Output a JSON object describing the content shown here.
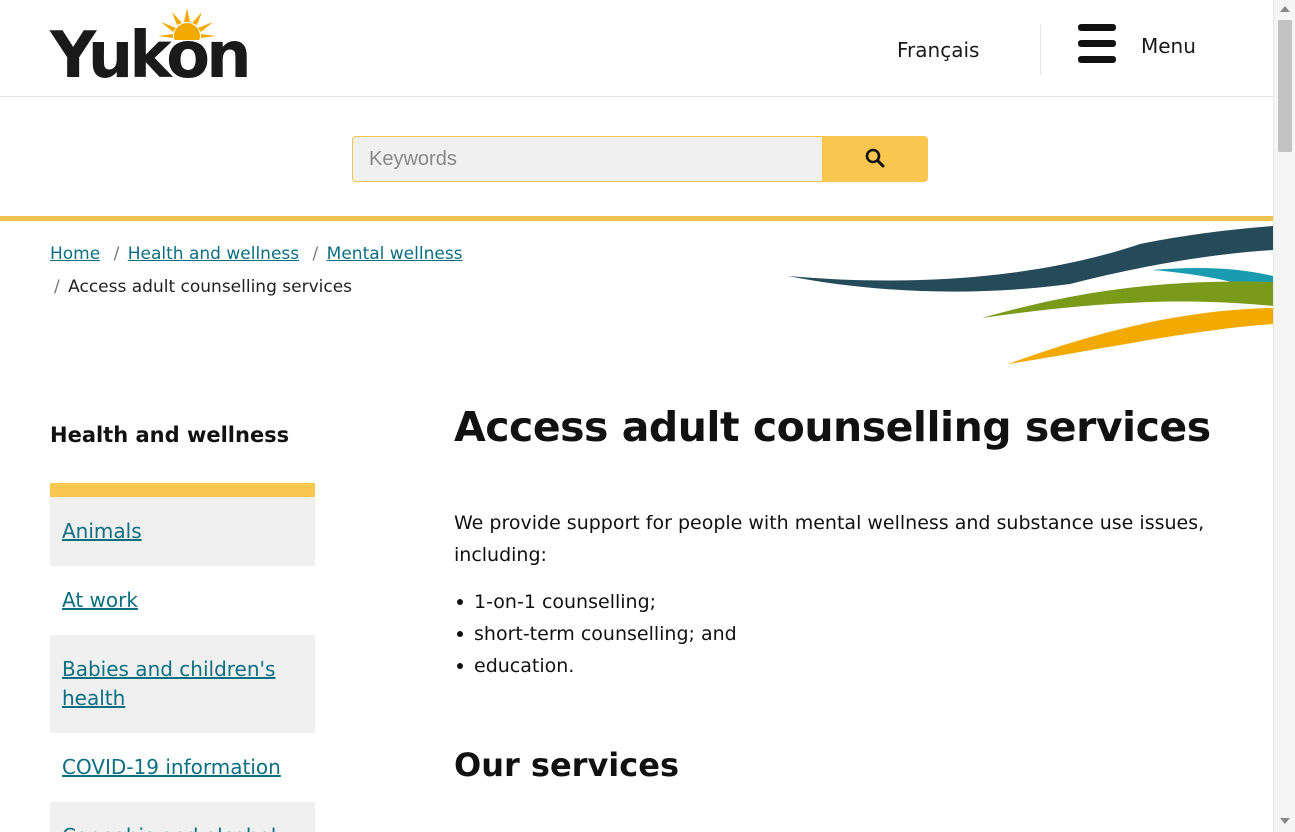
{
  "header": {
    "logo_text": "Yukon",
    "language_link": "Français",
    "menu_label": "Menu"
  },
  "search": {
    "placeholder": "Keywords",
    "value": ""
  },
  "breadcrumb": {
    "items": [
      "Home",
      "Health and wellness",
      "Mental wellness"
    ],
    "current": "Access adult counselling services"
  },
  "sidebar": {
    "title": "Health and wellness",
    "items": [
      {
        "label": "Animals"
      },
      {
        "label": "At work"
      },
      {
        "label": "Babies and children's health"
      },
      {
        "label": "COVID-19 information"
      },
      {
        "label": "Cannabis and alcohol"
      }
    ]
  },
  "main": {
    "title": "Access adult counselling services",
    "intro": "We provide support for people with mental wellness and substance use issues, including:",
    "bullets": [
      "1-on-1 counselling;",
      "short-term counselling; and",
      "education."
    ],
    "section_title": "Our services"
  },
  "colors": {
    "accent_yellow": "#f9c74f",
    "link_teal": "#0b6e81",
    "swoosh_navy": "#254b5a",
    "swoosh_teal": "#1a9cb0",
    "swoosh_green": "#7a9a1a",
    "swoosh_orange": "#f2a900"
  }
}
